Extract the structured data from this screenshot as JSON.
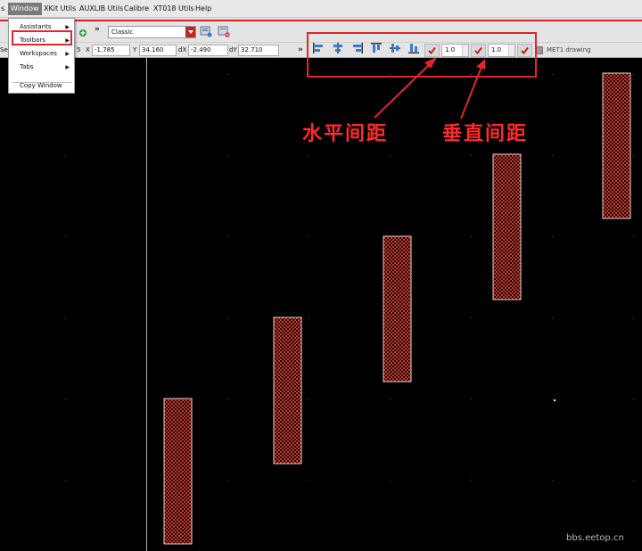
{
  "menubar": {
    "partial": "s",
    "window": "Window",
    "xkit": "XKit Utils",
    "auxlib": "AUXLIB Utils",
    "calibre": "Calibre",
    "xt018": "XT018 Utils",
    "help": "Help"
  },
  "window_menu": {
    "assistants": "Assistants",
    "toolbars": "Toolbars",
    "workspaces": "Workspaces",
    "tabs": "Tabs",
    "copy_window": "Copy Window"
  },
  "toolbar": {
    "chevron": "»",
    "workspace_value": "Classic",
    "partial_se": "Se",
    "partial_num": "5",
    "x_label": "X",
    "x_value": "-1.785",
    "y_label": "Y",
    "y_value": "34.160",
    "dx_label": "dX",
    "dx_value": "-2.490",
    "dy_label": "dY",
    "dy_value": "32.710",
    "align_chevron": "»",
    "h_spacing_value": "1.0",
    "v_spacing_value": "1.0",
    "layer_value": "MET1 drawing"
  },
  "annotations": {
    "horizontal": "水平间距",
    "vertical": "垂直间距"
  },
  "watermark": "bbs.eetop.cn",
  "colors": {
    "annotation_red": "#e0262c",
    "rect_fill": "#c83a2a",
    "canvas": "#000000"
  },
  "icons": [
    "align-left-icon",
    "align-center-icon",
    "align-right-icon",
    "align-top-icon",
    "align-middle-icon",
    "align-bottom-icon",
    "checkmark-icon"
  ]
}
